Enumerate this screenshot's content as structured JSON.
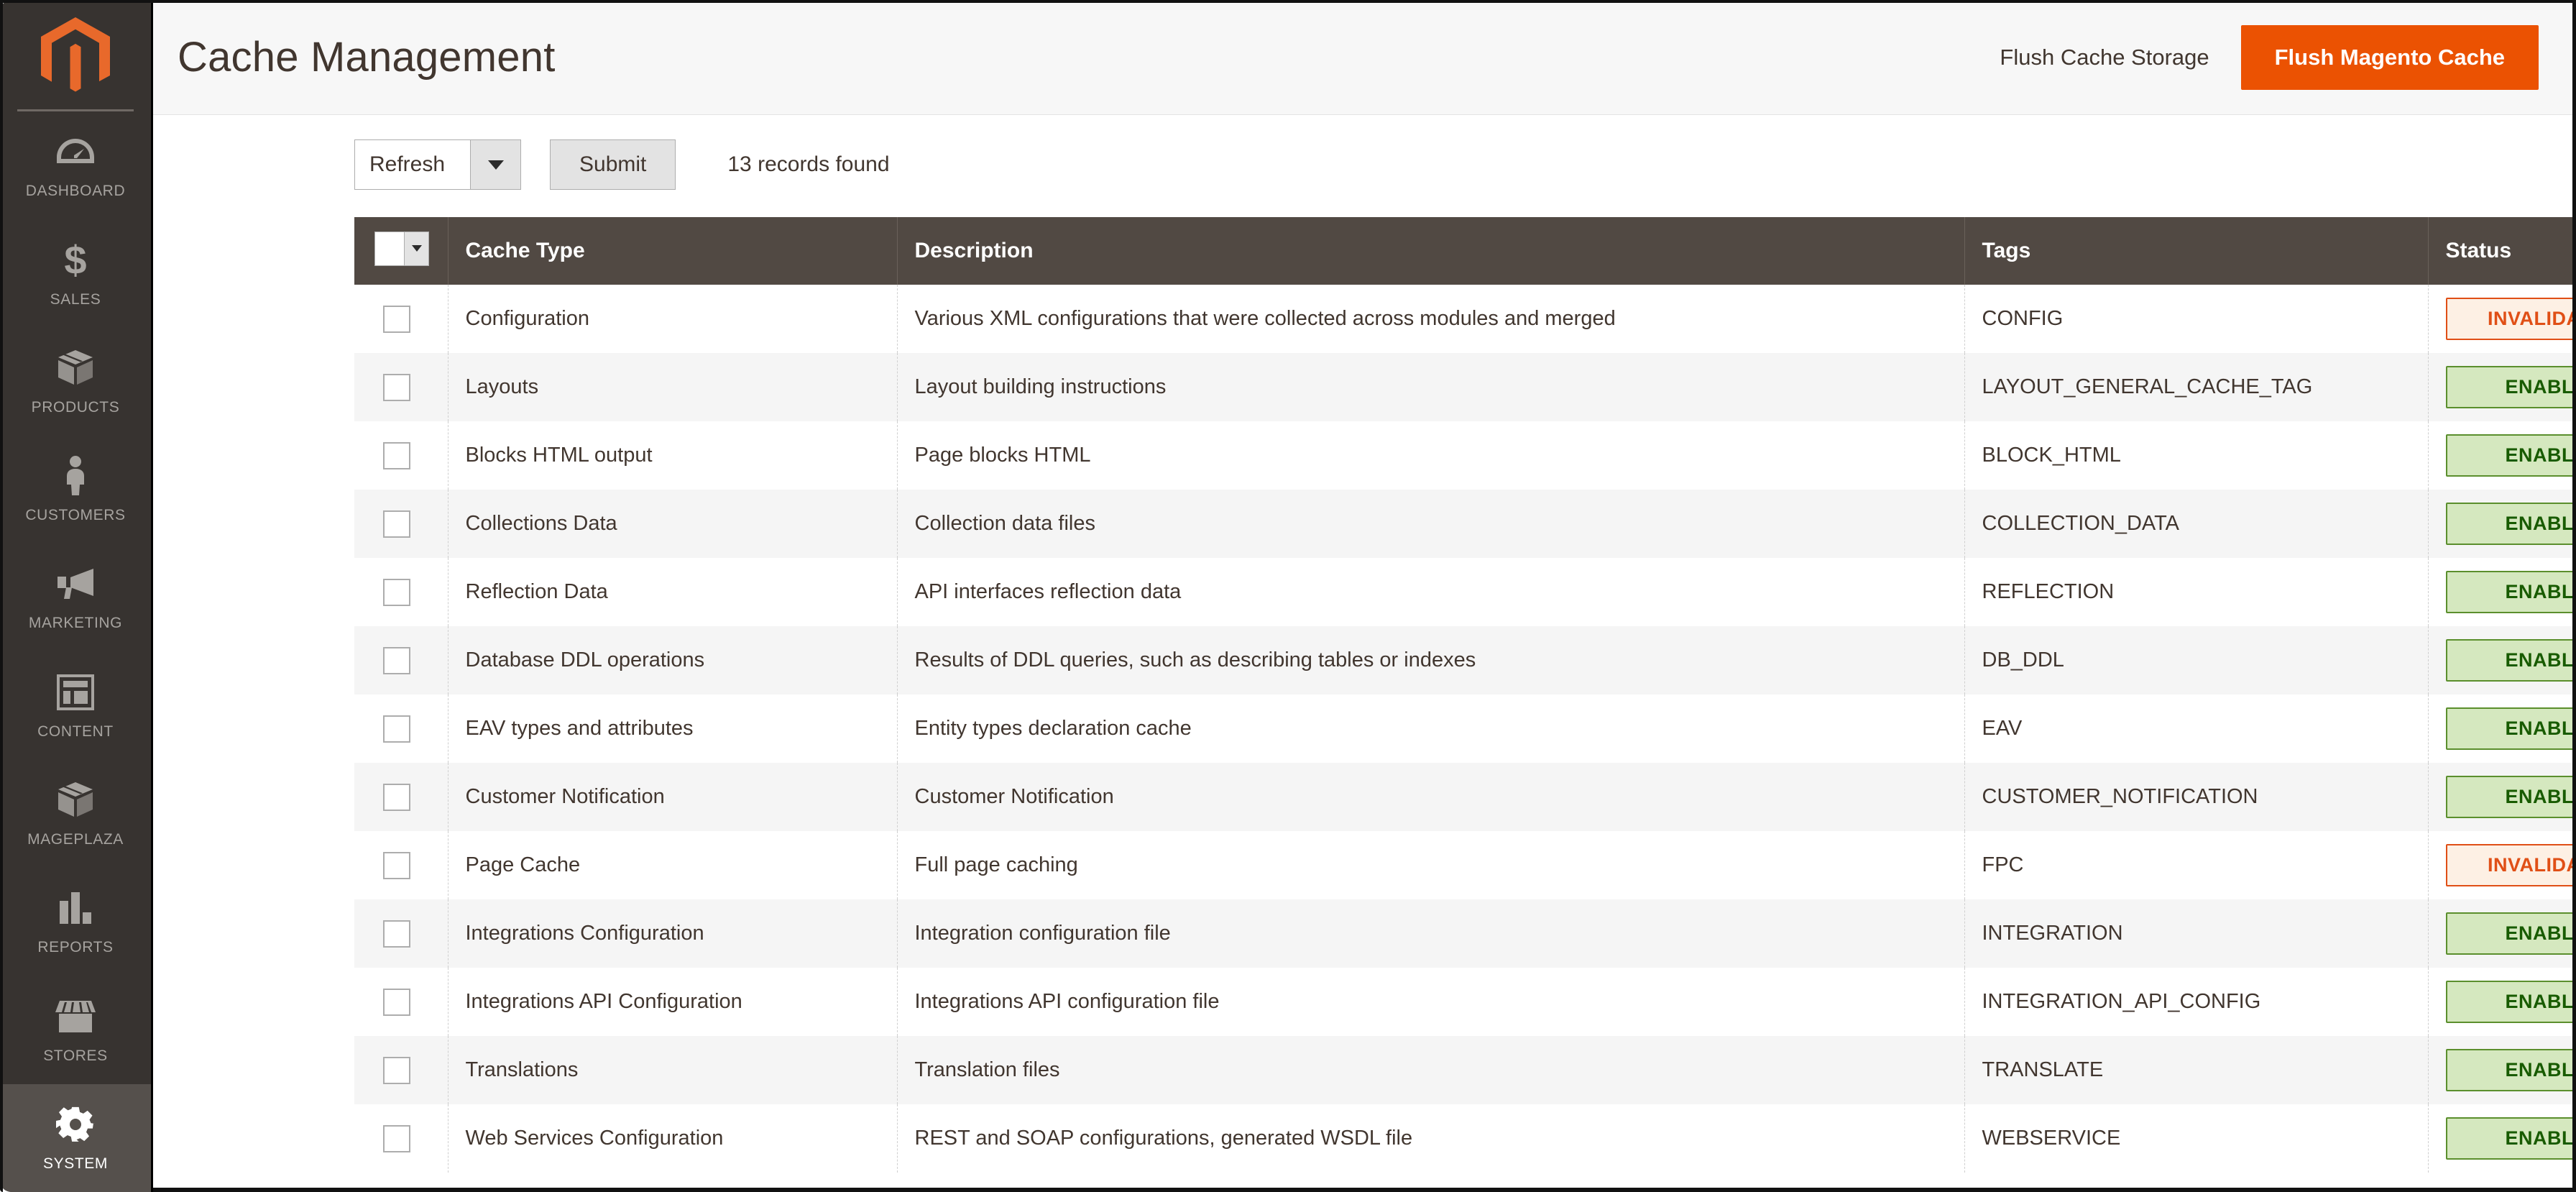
{
  "sidebar": {
    "logo_name": "magento-logo",
    "items": [
      {
        "label": "DASHBOARD",
        "icon": "dashboard-gauge-icon",
        "active": false
      },
      {
        "label": "SALES",
        "icon": "dollar-sign-icon",
        "active": false
      },
      {
        "label": "PRODUCTS",
        "icon": "box-icon",
        "active": false
      },
      {
        "label": "CUSTOMERS",
        "icon": "person-icon",
        "active": false
      },
      {
        "label": "MARKETING",
        "icon": "megaphone-icon",
        "active": false
      },
      {
        "label": "CONTENT",
        "icon": "layout-icon",
        "active": false
      },
      {
        "label": "MAGEPLAZA",
        "icon": "box-icon",
        "active": false
      },
      {
        "label": "REPORTS",
        "icon": "bar-chart-icon",
        "active": false
      },
      {
        "label": "STORES",
        "icon": "storefront-icon",
        "active": false
      },
      {
        "label": "SYSTEM",
        "icon": "gear-icon",
        "active": true
      }
    ]
  },
  "header": {
    "title": "Cache Management",
    "flush_cache_storage_label": "Flush Cache Storage",
    "flush_magento_cache_label": "Flush Magento Cache",
    "primary_color": "#eb5202"
  },
  "toolbar": {
    "action_selected": "Refresh",
    "submit_label": "Submit",
    "records_found": "13 records found"
  },
  "table": {
    "columns": [
      "Cache Type",
      "Description",
      "Tags",
      "Status"
    ],
    "rows": [
      {
        "type": "Configuration",
        "description": "Various XML configurations that were collected across modules and merged",
        "tags": "CONFIG",
        "status": "INVALIDATED"
      },
      {
        "type": "Layouts",
        "description": "Layout building instructions",
        "tags": "LAYOUT_GENERAL_CACHE_TAG",
        "status": "ENABLED"
      },
      {
        "type": "Blocks HTML output",
        "description": "Page blocks HTML",
        "tags": "BLOCK_HTML",
        "status": "ENABLED"
      },
      {
        "type": "Collections Data",
        "description": "Collection data files",
        "tags": "COLLECTION_DATA",
        "status": "ENABLED"
      },
      {
        "type": "Reflection Data",
        "description": "API interfaces reflection data",
        "tags": "REFLECTION",
        "status": "ENABLED"
      },
      {
        "type": "Database DDL operations",
        "description": "Results of DDL queries, such as describing tables or indexes",
        "tags": "DB_DDL",
        "status": "ENABLED"
      },
      {
        "type": "EAV types and attributes",
        "description": "Entity types declaration cache",
        "tags": "EAV",
        "status": "ENABLED"
      },
      {
        "type": "Customer Notification",
        "description": "Customer Notification",
        "tags": "CUSTOMER_NOTIFICATION",
        "status": "ENABLED"
      },
      {
        "type": "Page Cache",
        "description": "Full page caching",
        "tags": "FPC",
        "status": "INVALIDATED"
      },
      {
        "type": "Integrations Configuration",
        "description": "Integration configuration file",
        "tags": "INTEGRATION",
        "status": "ENABLED"
      },
      {
        "type": "Integrations API Configuration",
        "description": "Integrations API configuration file",
        "tags": "INTEGRATION_API_CONFIG",
        "status": "ENABLED"
      },
      {
        "type": "Translations",
        "description": "Translation files",
        "tags": "TRANSLATE",
        "status": "ENABLED"
      },
      {
        "type": "Web Services Configuration",
        "description": "REST and SOAP configurations, generated WSDL file",
        "tags": "WEBSERVICE",
        "status": "ENABLED"
      }
    ],
    "status_colors": {
      "enabled_bg": "#d5e8bf",
      "enabled_border": "#5b8f2d",
      "enabled_text": "#185b00",
      "invalidated_bg": "#fdf0e4",
      "invalidated_border": "#e04f16",
      "invalidated_text": "#e04f16"
    }
  }
}
